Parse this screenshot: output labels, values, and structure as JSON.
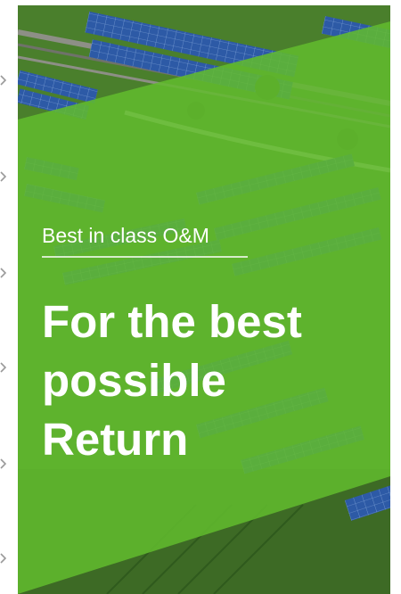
{
  "hero": {
    "eyebrow": "Best in class O&M",
    "headline_lines": [
      "For the best",
      "possible",
      "Return"
    ]
  },
  "colors": {
    "overlay_green": "#5fb82f",
    "text": "#ffffff",
    "panel_blue": "#2f5fae",
    "grass": "#4f8a2e",
    "chevron": "#9a9a9a"
  },
  "icons": {
    "rail": "chevron-right-icon"
  }
}
